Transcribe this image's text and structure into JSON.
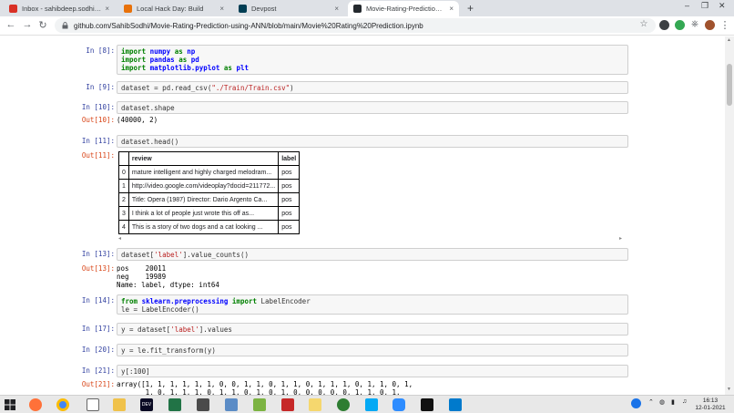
{
  "browser": {
    "tabs": [
      {
        "title": "Inbox - sahibdeep.sodhi@quantiq",
        "favicon": "gmail-icon",
        "color": "#d93025"
      },
      {
        "title": "Local Hack Day: Build",
        "favicon": "pencil-icon",
        "color": "#e8710a"
      },
      {
        "title": "Devpost",
        "favicon": "devpost-icon",
        "color": "#003e54"
      },
      {
        "title": "Movie-Rating-Prediction-using-ANN",
        "favicon": "github-icon",
        "color": "#24292e"
      }
    ],
    "active_tab": 3,
    "url": "github.com/SahibSodhi/Movie-Rating-Prediction-using-ANN/blob/main/Movie%20Rating%20Prediction.ipynb"
  },
  "notebook": {
    "cells": [
      {
        "prompt": "In [8]:",
        "type": "code",
        "lines": [
          [
            {
              "t": "import ",
              "c": "kw"
            },
            {
              "t": "numpy",
              "c": "mod"
            },
            {
              "t": " as ",
              "c": "kw"
            },
            {
              "t": "np",
              "c": "mod"
            }
          ],
          [
            {
              "t": "import ",
              "c": "kw"
            },
            {
              "t": "pandas",
              "c": "mod"
            },
            {
              "t": " as ",
              "c": "kw"
            },
            {
              "t": "pd",
              "c": "mod"
            }
          ],
          [
            {
              "t": "import ",
              "c": "kw"
            },
            {
              "t": "matplotlib.pyplot",
              "c": "mod"
            },
            {
              "t": " as ",
              "c": "kw"
            },
            {
              "t": "plt",
              "c": "mod"
            }
          ]
        ]
      },
      {
        "prompt": "In [9]:",
        "type": "code",
        "lines": [
          [
            {
              "t": "dataset = pd.read_csv(",
              "c": ""
            },
            {
              "t": "\"./Train/Train.csv\"",
              "c": "str"
            },
            {
              "t": ")",
              "c": ""
            }
          ]
        ]
      },
      {
        "prompt": "In [10]:",
        "type": "code",
        "lines": [
          [
            {
              "t": "dataset.shape",
              "c": ""
            }
          ]
        ]
      },
      {
        "prompt": "Out[10]:",
        "type": "out",
        "text": "(40000, 2)"
      },
      {
        "prompt": "In [11]:",
        "type": "code",
        "lines": [
          [
            {
              "t": "dataset.head()",
              "c": ""
            }
          ]
        ]
      },
      {
        "prompt": "Out[11]:",
        "type": "table"
      },
      {
        "prompt": "In [13]:",
        "type": "code",
        "lines": [
          [
            {
              "t": "dataset[",
              "c": ""
            },
            {
              "t": "'label'",
              "c": "str"
            },
            {
              "t": "].value_counts()",
              "c": ""
            }
          ]
        ]
      },
      {
        "prompt": "Out[13]:",
        "type": "out",
        "text": "pos    20011\nneg    19989\nName: label, dtype: int64"
      },
      {
        "prompt": "In [14]:",
        "type": "code",
        "lines": [
          [
            {
              "t": "from ",
              "c": "kw"
            },
            {
              "t": "sklearn.preprocessing",
              "c": "mod"
            },
            {
              "t": " import ",
              "c": "kw"
            },
            {
              "t": "LabelEncoder",
              "c": ""
            }
          ],
          [
            {
              "t": "le = LabelEncoder()",
              "c": ""
            }
          ]
        ]
      },
      {
        "prompt": "In [17]:",
        "type": "code",
        "lines": [
          [
            {
              "t": "y = dataset[",
              "c": ""
            },
            {
              "t": "'label'",
              "c": "str"
            },
            {
              "t": "].values",
              "c": ""
            }
          ]
        ]
      },
      {
        "prompt": "In [20]:",
        "type": "code",
        "lines": [
          [
            {
              "t": "y = le.fit_transform(y)",
              "c": ""
            }
          ]
        ]
      },
      {
        "prompt": "In [21]:",
        "type": "code",
        "lines": [
          [
            {
              "t": "y[:100]",
              "c": ""
            }
          ]
        ]
      },
      {
        "prompt": "Out[21]:",
        "type": "out",
        "text": "array([1, 1, 1, 1, 1, 1, 0, 0, 1, 1, 0, 1, 1, 0, 1, 1, 1, 0, 1, 1, 0, 1,\n       1, 0, 1, 1, 1, 0, 1, 1, 0, 1, 0, 1, 0, 0, 0, 0, 0, 1, 1, 0, 1,"
      }
    ],
    "head_table": {
      "columns": [
        "",
        "review",
        "label"
      ],
      "rows": [
        [
          "0",
          "mature intelligent and highly charged melodram...",
          "pos"
        ],
        [
          "1",
          "http://video.google.com/videoplay?docid=211772...",
          "pos"
        ],
        [
          "2",
          "Title: Opera (1987) Director: Dario Argento Ca...",
          "pos"
        ],
        [
          "3",
          "I think a lot of people just wrote this off as...",
          "pos"
        ],
        [
          "4",
          "This is a story of two dogs and a cat looking ...",
          "pos"
        ]
      ]
    }
  },
  "taskbar": {
    "time": "16:13",
    "date": "12-01-2021"
  }
}
